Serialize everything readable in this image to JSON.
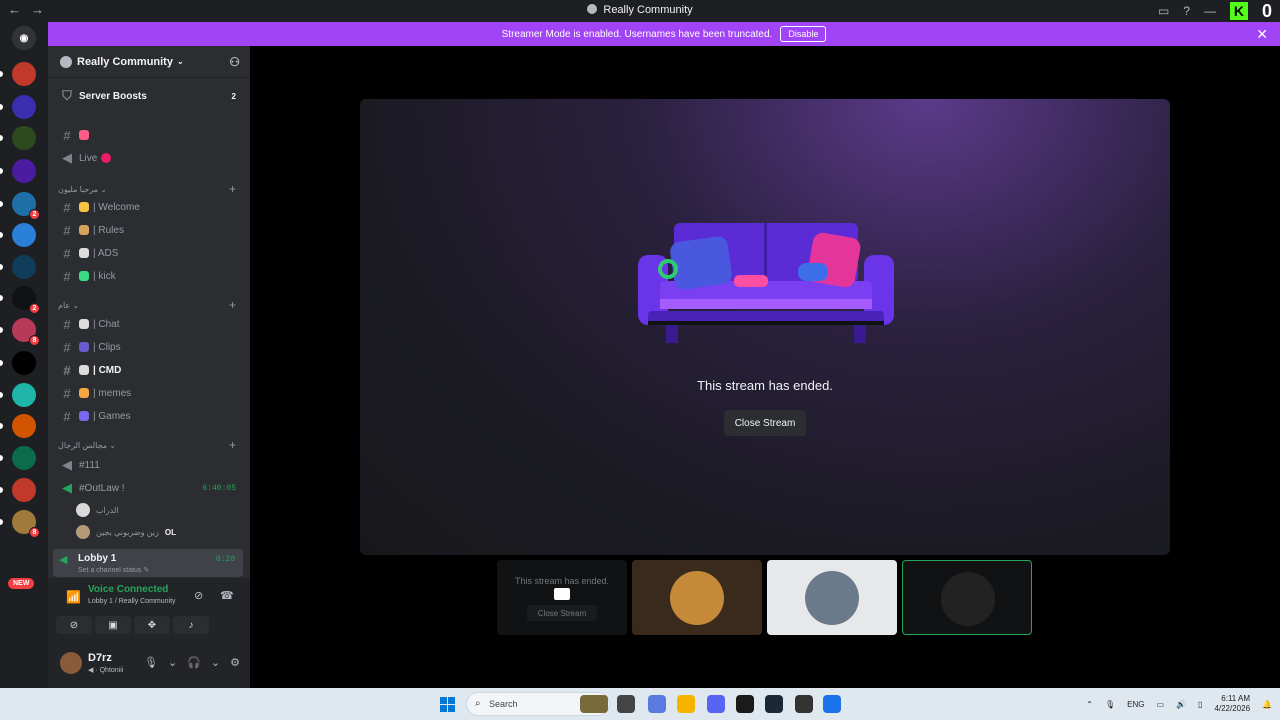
{
  "window": {
    "title": "Really Community",
    "nav_back": "←",
    "nav_forward": "→",
    "kick_letter": "K",
    "kick_count": "0"
  },
  "banner": {
    "text": "Streamer Mode is enabled. Usernames have been truncated.",
    "disable_label": "Disable",
    "close": "✕"
  },
  "server_list": {
    "new_badge": "NEW",
    "servers": [
      {
        "name": "server-1",
        "color": "#c0392b",
        "badge": ""
      },
      {
        "name": "server-2",
        "color": "#3b2fb0",
        "badge": ""
      },
      {
        "name": "server-3",
        "color": "#2d4a1e",
        "badge": ""
      },
      {
        "name": "server-4",
        "color": "#4b1ba0",
        "badge": ""
      },
      {
        "name": "server-5",
        "color": "#1e6fa8",
        "badge": "2"
      },
      {
        "name": "server-6",
        "color": "#2a7fd6",
        "badge": ""
      },
      {
        "name": "server-7",
        "color": "#0f3d5a",
        "badge": ""
      },
      {
        "name": "server-8",
        "color": "#111214",
        "badge": "2"
      },
      {
        "name": "server-9",
        "color": "#b83a5a",
        "badge": "8"
      },
      {
        "name": "server-10",
        "color": "#000000",
        "badge": ""
      },
      {
        "name": "server-11",
        "color": "#1fb5a8",
        "badge": ""
      },
      {
        "name": "server-12",
        "color": "#d35400",
        "badge": ""
      },
      {
        "name": "server-13",
        "color": "#0c6b4a",
        "badge": ""
      },
      {
        "name": "server-14",
        "color": "#c0392b",
        "badge": ""
      },
      {
        "name": "server-15",
        "color": "#a07a3a",
        "badge": "8"
      }
    ]
  },
  "sidebar": {
    "server_name": "Really Community",
    "server_boosts": "Server Boosts",
    "server_boosts_count": "2",
    "channels_top": [
      {
        "label": "",
        "type": "text",
        "emoji_color": "#ff5c8a"
      },
      {
        "label": "Live",
        "type": "voice",
        "emoji_color": "#e91e63"
      }
    ],
    "category1": "مرحبا مليون",
    "cat1_channels": [
      {
        "label": "| Welcome",
        "emoji_color": "#f4c542"
      },
      {
        "label": "| Rules",
        "emoji_color": "#d8a35d"
      },
      {
        "label": "| ADS",
        "emoji_color": "#dcdcdc"
      },
      {
        "label": "| kick",
        "emoji_color": "#3ddc84"
      }
    ],
    "category2": "عام",
    "cat2_channels": [
      {
        "label": "| Chat",
        "emoji_color": "#dcdcdc",
        "bold": false
      },
      {
        "label": "| Clips",
        "emoji_color": "#6a5acd",
        "bold": false
      },
      {
        "label": "| CMD",
        "emoji_color": "#dcdcdc",
        "bold": true
      },
      {
        "label": "| memes",
        "emoji_color": "#f4a742",
        "bold": false
      },
      {
        "label": "| Games",
        "emoji_color": "#7b68ee",
        "bold": false
      }
    ],
    "category3": "مجالس الرجال",
    "voice_111": "#111",
    "voice_outlaw": "#OutLaw !",
    "voice_outlaw_timer": "6:40:05",
    "voice_users": [
      {
        "name": "الدراب"
      },
      {
        "name": "زين وضربوني بجين"
      }
    ],
    "voice_user_tag": "OL",
    "lobby_name": "Lobby 1",
    "lobby_status": "Set a channel status",
    "lobby_timer": "8:20"
  },
  "voice_panel": {
    "title": "Voice Connected",
    "subtitle": "Lobby 1 / Really Community"
  },
  "user": {
    "name": "D7rz",
    "status": "Qhtoniii"
  },
  "stream": {
    "ended_text": "This stream has ended.",
    "close_label": "Close Stream"
  },
  "thumbnails": {
    "t1_text": "This stream has ended.",
    "t1_button": "Close Stream",
    "avatar_colors": [
      "#c48a3a",
      "#6b7a8a",
      "#222222"
    ]
  },
  "taskbar": {
    "search_placeholder": "Search",
    "lang": "ENG",
    "time": "6:11 AM",
    "date": "4/22/2026",
    "app_colors": [
      "#7a6a3a",
      "#444444",
      "#5a7ae0",
      "#f4b400",
      "#5865f2",
      "#1a1a1a",
      "#1b2838",
      "#333333",
      "#1a73e8"
    ]
  }
}
